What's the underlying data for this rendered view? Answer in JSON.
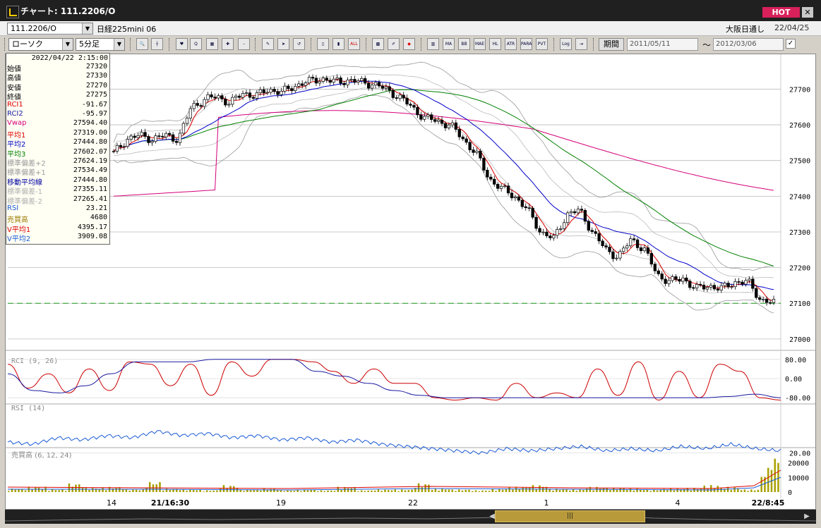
{
  "window": {
    "title": "チャート: 111.2206/O",
    "hot_label": "HOT",
    "close_glyph": "✕"
  },
  "symbol_bar": {
    "code": "111.2206/O",
    "name": "日経225mini 06",
    "market": "大阪日通し",
    "date": "22/04/25"
  },
  "toolbar": {
    "chart_type": "ローソク",
    "interval": "5分足",
    "period_label": "期間",
    "date_from": "2011/05/11",
    "date_to": "2012/03/06",
    "tilde": "〜",
    "check_glyph": "✓",
    "tools": [
      "zoom-icon",
      "crosshair-icon",
      "mark-buy-icon",
      "search-q-icon",
      "calendar-icon",
      "dash-icon",
      "pen-icon",
      "cursor-icon",
      "hand-icon",
      "candle-icon",
      "candle2-icon",
      "all-icon",
      "grid-icon",
      "brush-icon",
      "palette-icon",
      "ma-icon",
      "bb-icon",
      "mae-icon",
      "hl-icon",
      "atr-icon",
      "para-icon",
      "pvt-icon",
      "log-icon",
      "export-icon"
    ],
    "tool_labels": {
      "all": "ALL",
      "ma": "MA",
      "bb": "BB",
      "mae": "MAE",
      "hl": "HL",
      "atr": "ATR",
      "para": "PARA",
      "pvt": "PVT",
      "log": "Log"
    }
  },
  "info_panel": {
    "datetime": "2022/04/22 2:15:00",
    "rows": [
      {
        "label": "始値",
        "value": "27320",
        "color": "#000000"
      },
      {
        "label": "高値",
        "value": "27330",
        "color": "#000000"
      },
      {
        "label": "安値",
        "value": "27270",
        "color": "#000000"
      },
      {
        "label": "終値",
        "value": "27275",
        "color": "#000000"
      },
      {
        "label": "RCI1",
        "value": "-91.67",
        "color": "#dd0000"
      },
      {
        "label": "RCI2",
        "value": "-95.97",
        "color": "#1a1aa0"
      },
      {
        "label": "Vwap",
        "value": "27594.40",
        "color": "#d4007a"
      },
      {
        "label": "平均1",
        "value": "27319.00",
        "color": "#dd0000"
      },
      {
        "label": "平均2",
        "value": "27444.80",
        "color": "#0000c8"
      },
      {
        "label": "平均3",
        "value": "27602.07",
        "color": "#008000"
      },
      {
        "label": "標準偏差+2",
        "value": "27624.19",
        "color": "#9a9a9a"
      },
      {
        "label": "標準偏差+1",
        "value": "27534.49",
        "color": "#9a9a9a"
      },
      {
        "label": "移動平均線",
        "value": "27444.80",
        "color": "#0000a0"
      },
      {
        "label": "標準偏差-1",
        "value": "27355.11",
        "color": "#b0b0b0"
      },
      {
        "label": "標準偏差-2",
        "value": "27265.41",
        "color": "#b0b0b0"
      },
      {
        "label": "RSI",
        "value": "23.21",
        "color": "#1a5ad6"
      },
      {
        "label": "売買高",
        "value": "4680",
        "color": "#9a7a00"
      },
      {
        "label": "V平均1",
        "value": "4395.17",
        "color": "#dd0000"
      },
      {
        "label": "V平均2",
        "value": "3909.08",
        "color": "#1a5ad6"
      }
    ]
  },
  "chart_data": [
    {
      "type": "candlestick",
      "ylim": [
        26980,
        27770
      ],
      "yticks": [
        27000,
        27100,
        27200,
        27300,
        27400,
        27500,
        27600,
        27700
      ],
      "ytick_labels": [
        "27000",
        "27100",
        "27200",
        "27300",
        "27400",
        "27500",
        "27600",
        "27700"
      ],
      "reference_line": 27100,
      "x_labels": [
        "14",
        "21/16:30",
        "19",
        "22",
        "1",
        "4",
        "22/8:45"
      ],
      "x_label_bold": [
        false,
        true,
        false,
        false,
        false,
        false,
        true
      ],
      "ohlc_anchors": [
        27520,
        27560,
        27570,
        27560,
        27570,
        27560,
        27650,
        27670,
        27680,
        27660,
        27690,
        27680,
        27700,
        27690,
        27710,
        27720,
        27730,
        27720,
        27725,
        27720,
        27715,
        27700,
        27680,
        27650,
        27620,
        27610,
        27600,
        27560,
        27520,
        27450,
        27420,
        27400,
        27360,
        27300,
        27280,
        27350,
        27360,
        27300,
        27250,
        27230,
        27280,
        27250,
        27180,
        27160,
        27170,
        27140,
        27150,
        27140,
        27160,
        27160,
        27110,
        27100
      ]
    },
    {
      "type": "line",
      "title": "RCI (9, 26)",
      "ylim": [
        -100,
        100
      ],
      "yticks": [
        80,
        0,
        -80
      ],
      "ytick_labels": [
        "80.00",
        "0.00",
        "-80.00"
      ],
      "series": [
        {
          "color": "#cc0000",
          "values": [
            60,
            -40,
            20,
            -60,
            40,
            -50,
            70,
            60,
            -30,
            60,
            -70,
            70,
            10,
            80,
            80,
            70,
            30,
            -20,
            40,
            -20,
            -20,
            -80,
            -90,
            -80,
            -90,
            -20,
            -80,
            -60,
            -80,
            40,
            -70,
            70,
            -90,
            30,
            -80,
            60,
            30,
            -80,
            -90
          ]
        },
        {
          "color": "#1a1aa0",
          "values": [
            20,
            -50,
            -60,
            -30,
            20,
            70,
            70,
            70,
            80,
            80,
            80,
            80,
            30,
            10,
            -20,
            -50,
            -70,
            -80,
            -80,
            -80,
            -80,
            -80,
            -80,
            -80,
            -80,
            -80,
            -80,
            -80,
            -75,
            -65,
            -80
          ]
        }
      ]
    },
    {
      "type": "line",
      "title": "RSI (14)",
      "ylim": [
        0,
        100
      ],
      "yticks": [
        20
      ],
      "ytick_labels": [
        "20.00"
      ],
      "series": [
        {
          "color": "#1a5ad6",
          "values": [
            45,
            40,
            55,
            50,
            60,
            55,
            70,
            60,
            65,
            55,
            60,
            50,
            55,
            45,
            50,
            40,
            35,
            30,
            25,
            20,
            30,
            25,
            30,
            35,
            25,
            30,
            25,
            35,
            30,
            40,
            30,
            25
          ]
        }
      ]
    },
    {
      "type": "bar",
      "title": "売買高 (6, 12, 24)",
      "ylim": [
        0,
        30000
      ],
      "yticks": [
        20000,
        10000,
        0
      ],
      "ytick_labels": [
        "20000",
        "10000",
        "0"
      ],
      "values": [
        2000,
        3000,
        1500,
        5000,
        2500,
        3000,
        1500,
        6000,
        2000,
        1500,
        1000,
        4000,
        1500,
        2000,
        1000,
        1500,
        1000,
        3000,
        1000,
        1500,
        1500,
        5000,
        2000,
        1500,
        1000,
        2000,
        3000,
        4000,
        2000,
        1500,
        3000,
        2500,
        2000,
        1500,
        2000,
        2500,
        4000,
        3000,
        1500,
        20000,
        26000
      ]
    }
  ],
  "scroll": {
    "thumb_glyph": "|||",
    "left_glyph": "◀",
    "right_glyph": "▶"
  }
}
